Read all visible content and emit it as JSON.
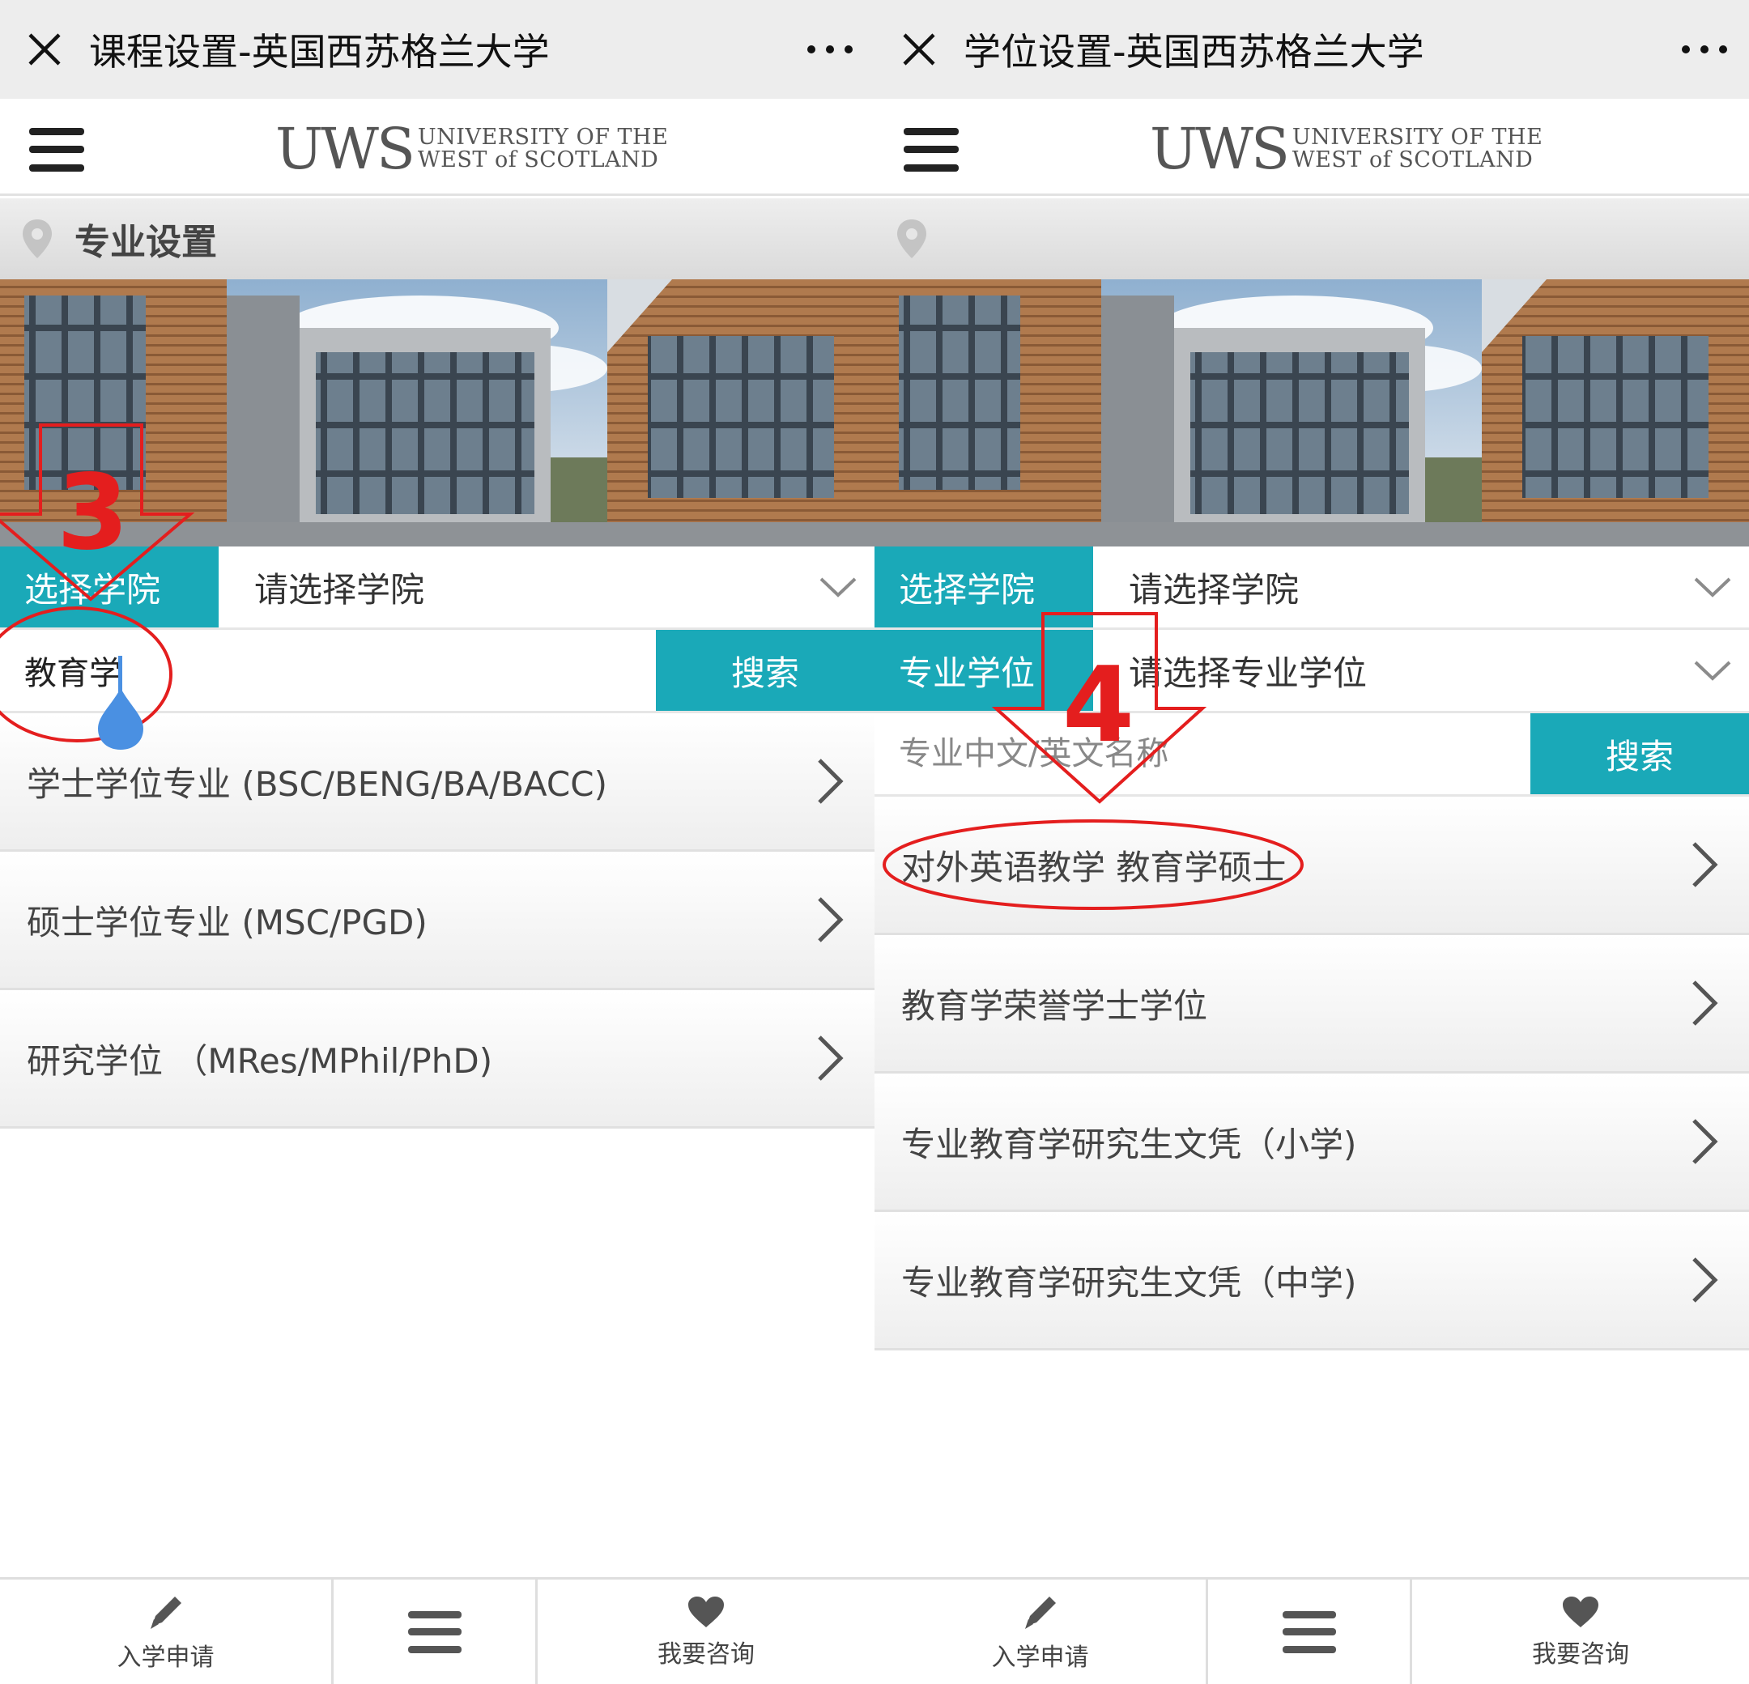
{
  "left": {
    "title": "课程设置-英国西苏格兰大学",
    "logo": {
      "wordmark": "UWS",
      "line1": "UNIVERSITY OF THE",
      "line2": "WEST of SCOTLAND"
    },
    "breadcrumb": "专业设置",
    "college_label": "选择学院",
    "college_value": "请选择学院",
    "search_value": "教育学",
    "search_button": "搜索",
    "items": [
      "学士学位专业 (BSC/BENG/BA/BACC)",
      "硕士学位专业 (MSC/PGD)",
      "研究学位 （MRes/MPhil/PhD)"
    ],
    "step": "3"
  },
  "right": {
    "title": "学位设置-英国西苏格兰大学",
    "logo": {
      "wordmark": "UWS",
      "line1": "UNIVERSITY OF THE",
      "line2": "WEST of SCOTLAND"
    },
    "college_label": "选择学院",
    "college_value": "请选择学院",
    "degree_label": "专业学位",
    "degree_value": "请选择专业学位",
    "search_placeholder": "专业中文/英文名称",
    "search_button": "搜索",
    "items": [
      "对外英语教学 教育学硕士",
      "教育学荣誉学士学位",
      "专业教育学研究生文凭（小学)",
      "专业教育学研究生文凭（中学)"
    ],
    "step": "4"
  },
  "tabbar": {
    "apply": "入学申请",
    "consult": "我要咨询"
  },
  "icons": [
    "close-icon",
    "more-icon",
    "hamburger-icon",
    "location-pin-icon",
    "chevron-down-icon",
    "chevron-right-icon",
    "pencil-icon",
    "menu-icon",
    "heart-icon"
  ],
  "colors": {
    "accent": "#1aa9b8",
    "annotation": "#e41e1e",
    "titlebar": "#ededed",
    "cursor": "#4a90e2"
  }
}
